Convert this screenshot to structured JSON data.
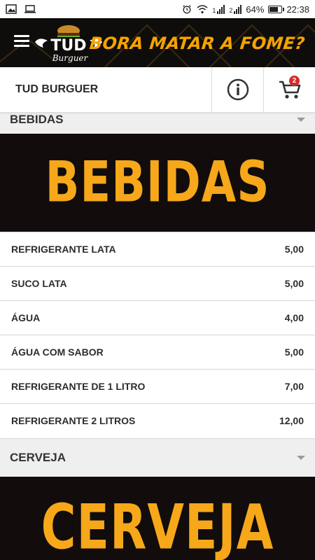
{
  "status_bar": {
    "battery": "64%",
    "time": "22:38",
    "battery_level": 0.64,
    "signal_1": "1",
    "signal_2": "2"
  },
  "banner": {
    "logo_main": "TUD",
    "logo_sub": "Burguer",
    "slogan": "BORA MATAR A FOME?"
  },
  "header": {
    "store_name": "TUD BURGUER",
    "cart_count": "2"
  },
  "categories": [
    {
      "label": "BEBIDAS",
      "banner_text": "BEBIDAS",
      "items": [
        {
          "name": "REFRIGERANTE LATA",
          "price": "5,00"
        },
        {
          "name": "SUCO LATA",
          "price": "5,00"
        },
        {
          "name": "ÁGUA",
          "price": "4,00"
        },
        {
          "name": "ÁGUA COM SABOR",
          "price": "5,00"
        },
        {
          "name": "REFRIGERANTE DE 1 LITRO",
          "price": "7,00"
        },
        {
          "name": "REFRIGERANTE 2 LITROS",
          "price": "12,00"
        }
      ]
    },
    {
      "label": "CERVEJA",
      "banner_text": "CERVEJA"
    }
  ],
  "colors": {
    "accent": "#f5a300",
    "banner_bg": "#0f0d0c",
    "badge": "#d42a2a"
  }
}
